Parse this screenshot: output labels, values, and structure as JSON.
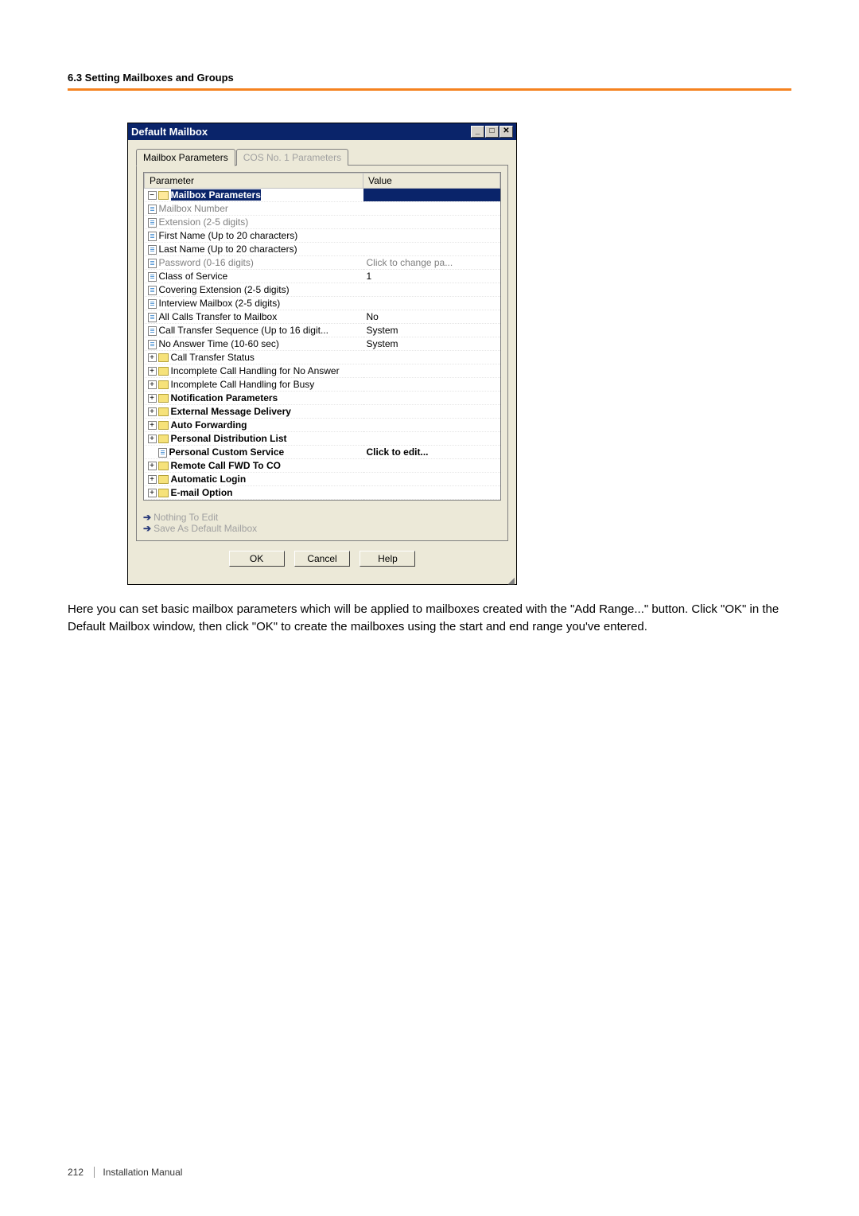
{
  "header": {
    "section": "6.3 Setting Mailboxes and Groups"
  },
  "dialog": {
    "title": "Default Mailbox",
    "tabs": {
      "active": "Mailbox Parameters",
      "inactive": "COS No. 1 Parameters"
    },
    "columns": {
      "param": "Parameter",
      "value": "Value"
    },
    "rows": {
      "r0": {
        "label": "Mailbox Parameters",
        "value": ""
      },
      "r1": {
        "label": "Mailbox Number",
        "value": ""
      },
      "r2": {
        "label": "Extension (2-5 digits)",
        "value": ""
      },
      "r3": {
        "label": "First Name (Up to 20 characters)",
        "value": ""
      },
      "r4": {
        "label": "Last Name (Up to 20 characters)",
        "value": ""
      },
      "r5": {
        "label": "Password (0-16 digits)",
        "value": "Click to change pa..."
      },
      "r6": {
        "label": "Class of Service",
        "value": "1"
      },
      "r7": {
        "label": "Covering Extension (2-5 digits)",
        "value": ""
      },
      "r8": {
        "label": "Interview Mailbox (2-5 digits)",
        "value": ""
      },
      "r9": {
        "label": "All Calls Transfer to Mailbox",
        "value": "No"
      },
      "r10": {
        "label": "Call Transfer Sequence (Up to 16 digit...",
        "value": "System"
      },
      "r11": {
        "label": "No Answer Time (10-60 sec)",
        "value": "System"
      },
      "r12": {
        "label": "Call Transfer Status",
        "value": ""
      },
      "r13": {
        "label": "Incomplete Call Handling for No Answer",
        "value": ""
      },
      "r14": {
        "label": "Incomplete Call Handling for Busy",
        "value": ""
      },
      "r15": {
        "label": "Notification Parameters",
        "value": ""
      },
      "r16": {
        "label": "External Message Delivery",
        "value": ""
      },
      "r17": {
        "label": "Auto Forwarding",
        "value": ""
      },
      "r18": {
        "label": "Personal Distribution List",
        "value": ""
      },
      "r19": {
        "label": "Personal Custom Service",
        "value": "Click to edit..."
      },
      "r20": {
        "label": "Remote Call FWD To CO",
        "value": ""
      },
      "r21": {
        "label": "Automatic Login",
        "value": ""
      },
      "r22": {
        "label": "E-mail Option",
        "value": ""
      }
    },
    "links": {
      "edit": "Nothing To Edit",
      "save": "Save As Default Mailbox"
    },
    "buttons": {
      "ok": "OK",
      "cancel": "Cancel",
      "help": "Help"
    }
  },
  "description": "Here you can set basic mailbox parameters which will be applied to mailboxes created with the \"Add Range...\" button. Click \"OK\" in the Default Mailbox window, then click \"OK\" to create the mailboxes using the start and end range you've entered.",
  "footer": {
    "page": "212",
    "doc": "Installation Manual"
  }
}
